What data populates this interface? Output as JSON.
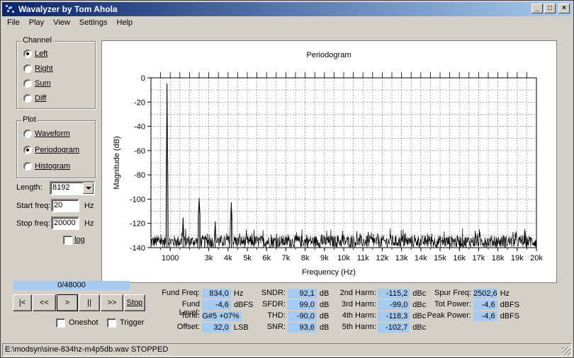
{
  "window": {
    "title": "Wavalyzer by Tom Ahola"
  },
  "title_buttons": {
    "minimize": "_",
    "maximize": "□",
    "close": "×"
  },
  "menu": [
    "File",
    "Play",
    "View",
    "Settings",
    "Help"
  ],
  "channel": {
    "title": "Channel",
    "options": [
      "Left",
      "Right",
      "Sum",
      "Diff"
    ],
    "selected": 0
  },
  "plot_group": {
    "title": "Plot",
    "options": [
      "Waveform",
      "Periodogram",
      "Histogram"
    ],
    "selected": 1
  },
  "length": {
    "label": "Length:",
    "value": "8192"
  },
  "start_freq": {
    "label": "Start freq:",
    "value": "20",
    "unit": "Hz"
  },
  "stop_freq": {
    "label": "Stop freq:",
    "value": "20000",
    "unit": "Hz"
  },
  "log_checkbox": {
    "label": "log",
    "checked": false
  },
  "progress": {
    "text": "0/48000",
    "fraction": 0
  },
  "transport": {
    "start": "|<",
    "rewind": "<<",
    "play": ">",
    "pause": "||",
    "forward": ">>",
    "stop": "Stop"
  },
  "oneshot": {
    "label": "Oneshot",
    "checked": false
  },
  "trigger": {
    "label": "Trigger",
    "checked": false
  },
  "stats": {
    "col1": [
      {
        "label": "Fund Freq:",
        "value": "834,0",
        "unit": "Hz"
      },
      {
        "label": "Fund Level:",
        "value": "-4,6",
        "unit": "dBFS"
      },
      {
        "label": "Tone:",
        "value": "G#5 +07%",
        "unit": ""
      },
      {
        "label": "Offset:",
        "value": "32,0",
        "unit": "LSB"
      }
    ],
    "col2": [
      {
        "label": "SNDR:",
        "value": "92,1",
        "unit": "dB"
      },
      {
        "label": "SFDR:",
        "value": "99,0",
        "unit": "dB"
      },
      {
        "label": "THD:",
        "value": "-90,0",
        "unit": "dB"
      },
      {
        "label": "SNR:",
        "value": "93,6",
        "unit": "dB"
      }
    ],
    "col3": [
      {
        "label": "2nd Harm:",
        "value": "-115,2",
        "unit": "dBc"
      },
      {
        "label": "3rd Harm:",
        "value": "-99,0",
        "unit": "dBc"
      },
      {
        "label": "4th Harm:",
        "value": "-118,3",
        "unit": "dBc"
      },
      {
        "label": "5th Harm:",
        "value": "-102,7",
        "unit": "dBc"
      }
    ],
    "col4": [
      {
        "label": "Spur Freq:",
        "value": "2502,6",
        "unit": "Hz"
      },
      {
        "label": "Tot Power:",
        "value": "-4,6",
        "unit": "dBFS"
      },
      {
        "label": "Peak Power:",
        "value": "-4,6",
        "unit": "dBFS"
      }
    ]
  },
  "status": {
    "text": "E:\\modsyn\\sine-834hz-m4p5db.wav STOPPED"
  },
  "colors": {
    "titlebar_start": "#0a246a",
    "highlight": "#a6caf0",
    "face": "#d4d0c8"
  },
  "chart_data": {
    "type": "line",
    "title": "Periodogram",
    "xlabel": "Frequency (Hz)",
    "ylabel": "Magnitude (dB)",
    "xlim": [
      0,
      20000
    ],
    "ylim": [
      -140,
      0
    ],
    "x_tick_labels": [
      "1000",
      "3k",
      "4k",
      "5k",
      "6k",
      "7k",
      "8k",
      "9k",
      "10k",
      "11k",
      "12k",
      "13k",
      "14k",
      "15k",
      "16k",
      "17k",
      "18k",
      "19k",
      "20k"
    ],
    "x_tick_values": [
      1000,
      3000,
      4000,
      5000,
      6000,
      7000,
      8000,
      9000,
      10000,
      11000,
      12000,
      13000,
      14000,
      15000,
      16000,
      17000,
      18000,
      19000,
      20000
    ],
    "y_tick_values": [
      0,
      -20,
      -40,
      -60,
      -80,
      -100,
      -120,
      -140
    ],
    "noise_floor_db": [
      -140,
      -130
    ],
    "grid": true,
    "series": [
      {
        "peaks": [
          {
            "freq": 834,
            "db": -4.6
          },
          {
            "freq": 1668,
            "db": -115.2
          },
          {
            "freq": 2502,
            "db": -99.0
          },
          {
            "freq": 3336,
            "db": -118.3
          },
          {
            "freq": 4170,
            "db": -102.7
          }
        ]
      }
    ]
  }
}
